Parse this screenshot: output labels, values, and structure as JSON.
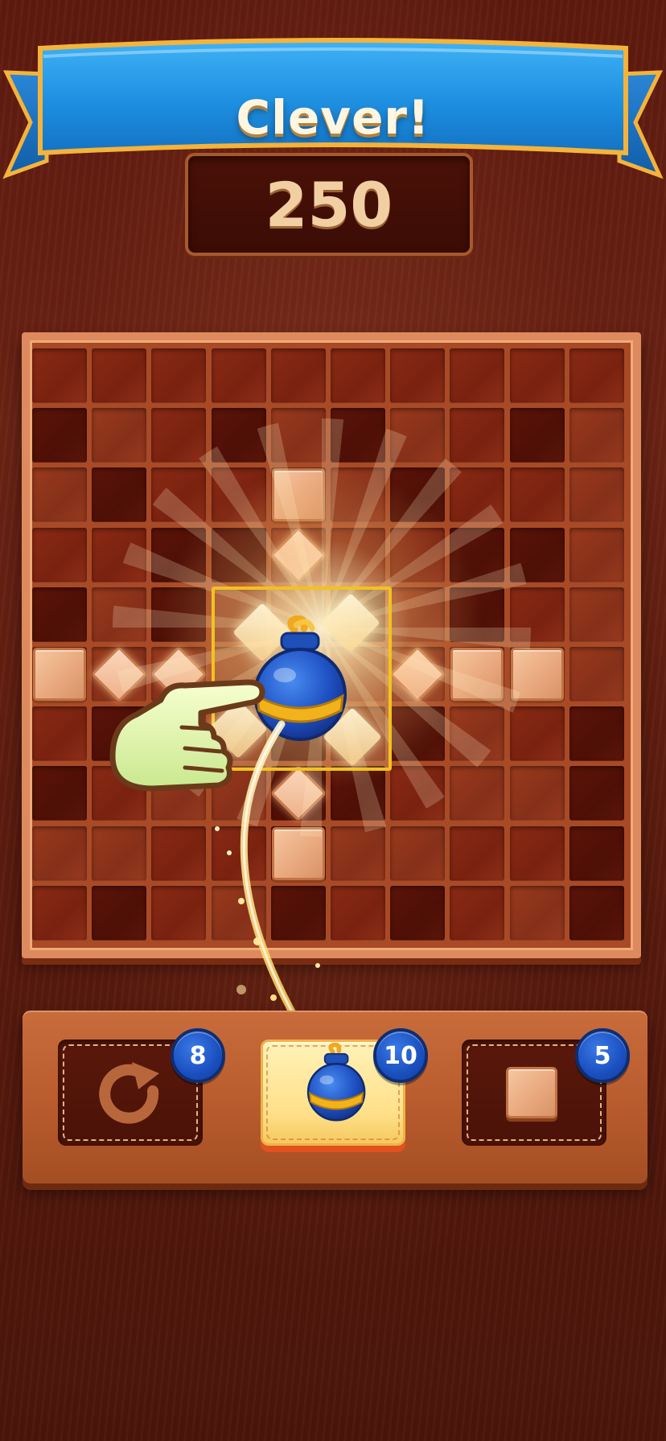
{
  "banner": {
    "title": "Clever!"
  },
  "score": {
    "value": "250"
  },
  "board": {
    "size": "10x10",
    "blocks": [
      [
        2,
        4
      ],
      [
        5,
        0
      ],
      [
        5,
        7
      ],
      [
        5,
        8
      ],
      [
        8,
        4
      ]
    ],
    "diamonds": [
      [
        3,
        4
      ],
      [
        5,
        1
      ],
      [
        5,
        2
      ],
      [
        5,
        6
      ],
      [
        7,
        4
      ]
    ],
    "highlight_area": "3x3 around bomb"
  },
  "boosters": [
    {
      "name": "undo",
      "icon": "undo-icon",
      "count": "8",
      "state": "idle"
    },
    {
      "name": "bomb",
      "icon": "bomb-icon",
      "count": "10",
      "state": "selected"
    },
    {
      "name": "single-block",
      "icon": "block-icon",
      "count": "5",
      "state": "idle"
    }
  ],
  "colors": {
    "banner_blue": "#1e8fe0",
    "banner_gold": "#f4b33b",
    "board_frame": "#dd8a5e",
    "highlight": "#f2c21f",
    "badge_blue": "#1b4fbf"
  }
}
